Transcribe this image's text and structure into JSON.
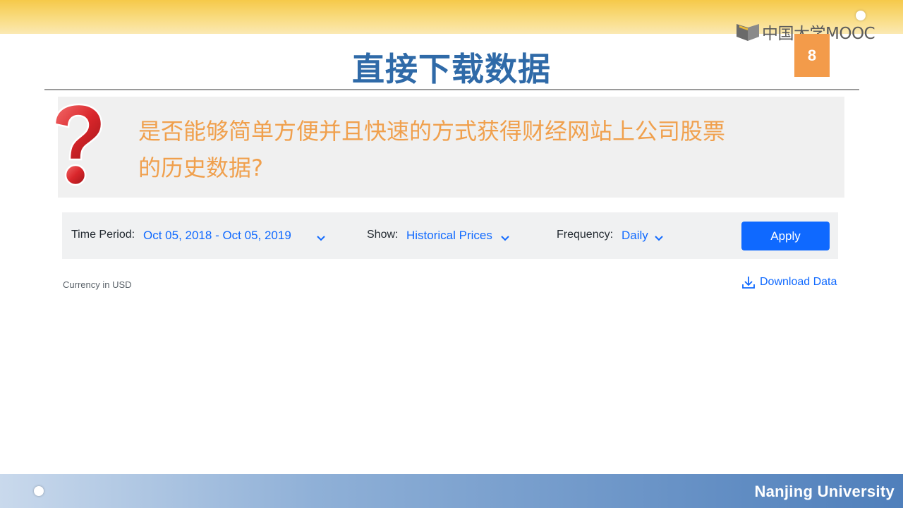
{
  "slide": {
    "title": "直接下载数据",
    "page_number": "8",
    "logo_text": "中国大学MOOC",
    "footer": "Nanjing University",
    "question_line1": "是否能够简单方便并且快速的方式获得财经网站上公司股票",
    "question_line2": "的历史数据?",
    "question_icon": "question-mark-icon"
  },
  "finance_ui": {
    "time_period_label": "Time Period:",
    "time_period_value": "Oct 05, 2018 - Oct 05, 2019",
    "show_label": "Show:",
    "show_value": "Historical Prices",
    "frequency_label": "Frequency:",
    "frequency_value": "Daily",
    "apply_label": "Apply",
    "currency_note": "Currency in USD",
    "download_label": "Download Data"
  },
  "colors": {
    "title": "#2f6aa8",
    "question_text": "#f0a04d",
    "accent_blue": "#0f69ff",
    "page_badge": "#f39b4a"
  }
}
